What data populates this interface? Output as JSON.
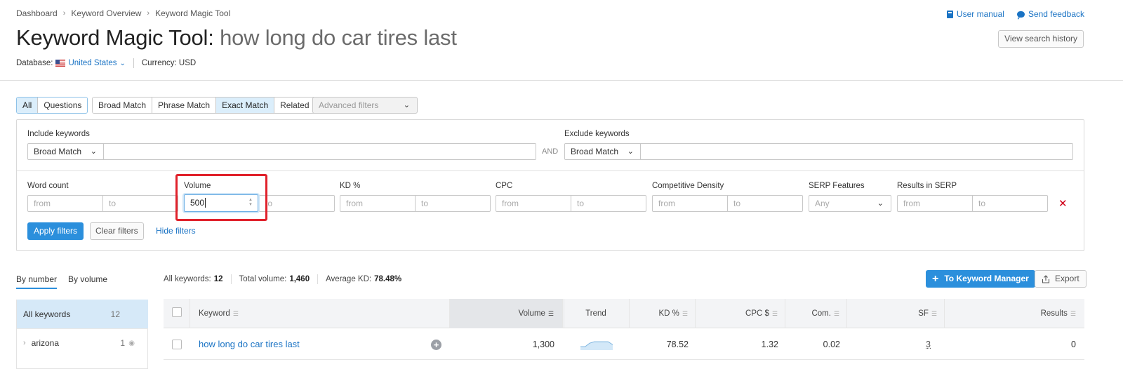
{
  "breadcrumb": [
    "Dashboard",
    "Keyword Overview",
    "Keyword Magic Tool"
  ],
  "header": {
    "title_prefix": "Keyword Magic Tool:",
    "query": "how long do car tires last",
    "database_label": "Database:",
    "database_value": "United States",
    "currency": "Currency: USD",
    "user_manual": "User manual",
    "send_feedback": "Send feedback",
    "view_history": "View search history"
  },
  "match_tabs": {
    "group1": [
      {
        "label": "All",
        "active": true
      },
      {
        "label": "Questions",
        "active": false
      }
    ],
    "group2": [
      {
        "label": "Broad Match",
        "active": false
      },
      {
        "label": "Phrase Match",
        "active": false
      },
      {
        "label": "Exact Match",
        "active": true
      },
      {
        "label": "Related",
        "active": false
      }
    ],
    "advanced_filters": "Advanced filters"
  },
  "filters": {
    "include_label": "Include keywords",
    "include_match": "Broad Match",
    "include_value": "",
    "and_label": "AND",
    "exclude_label": "Exclude keywords",
    "exclude_match": "Broad Match",
    "exclude_value": "",
    "from_placeholder": "from",
    "to_placeholder": "to",
    "word_count_label": "Word count",
    "volume_label": "Volume",
    "volume_from_value": "500",
    "kd_label": "KD %",
    "cpc_label": "CPC",
    "comp_density_label": "Competitive Density",
    "serp_features_label": "SERP Features",
    "serp_features_value": "Any",
    "results_label": "Results in SERP",
    "apply": "Apply filters",
    "clear": "Clear filters",
    "hide": "Hide filters"
  },
  "grouping": {
    "tabs": [
      {
        "label": "By number",
        "active": true
      },
      {
        "label": "By volume",
        "active": false
      }
    ],
    "items": [
      {
        "label": "All keywords",
        "count": "12",
        "active": true
      },
      {
        "label": "arizona",
        "count": "1",
        "active": false
      }
    ]
  },
  "stats": {
    "all_keywords_label": "All keywords:",
    "all_keywords_value": "12",
    "total_volume_label": "Total volume:",
    "total_volume_value": "1,460",
    "avg_kd_label": "Average KD:",
    "avg_kd_value": "78.48%"
  },
  "actions": {
    "to_keyword_manager": "To Keyword Manager",
    "export": "Export"
  },
  "table": {
    "columns": [
      "Keyword",
      "Volume",
      "Trend",
      "KD %",
      "CPC $",
      "Com.",
      "SF",
      "Results"
    ],
    "sorted_column": "Volume",
    "rows": [
      {
        "keyword": "how long do car tires last",
        "volume": "1,300",
        "trend": [
          0.35,
          0.35,
          0.7,
          0.85,
          0.85,
          0.85,
          0.85,
          0.55
        ],
        "kd": "78.52",
        "cpc": "1.32",
        "com": "0.02",
        "sf": "3",
        "results": "0"
      }
    ]
  },
  "colors": {
    "accent": "#2b8fdc",
    "link": "#1a73c4",
    "highlight": "#e0212b",
    "danger": "#d0021b"
  }
}
